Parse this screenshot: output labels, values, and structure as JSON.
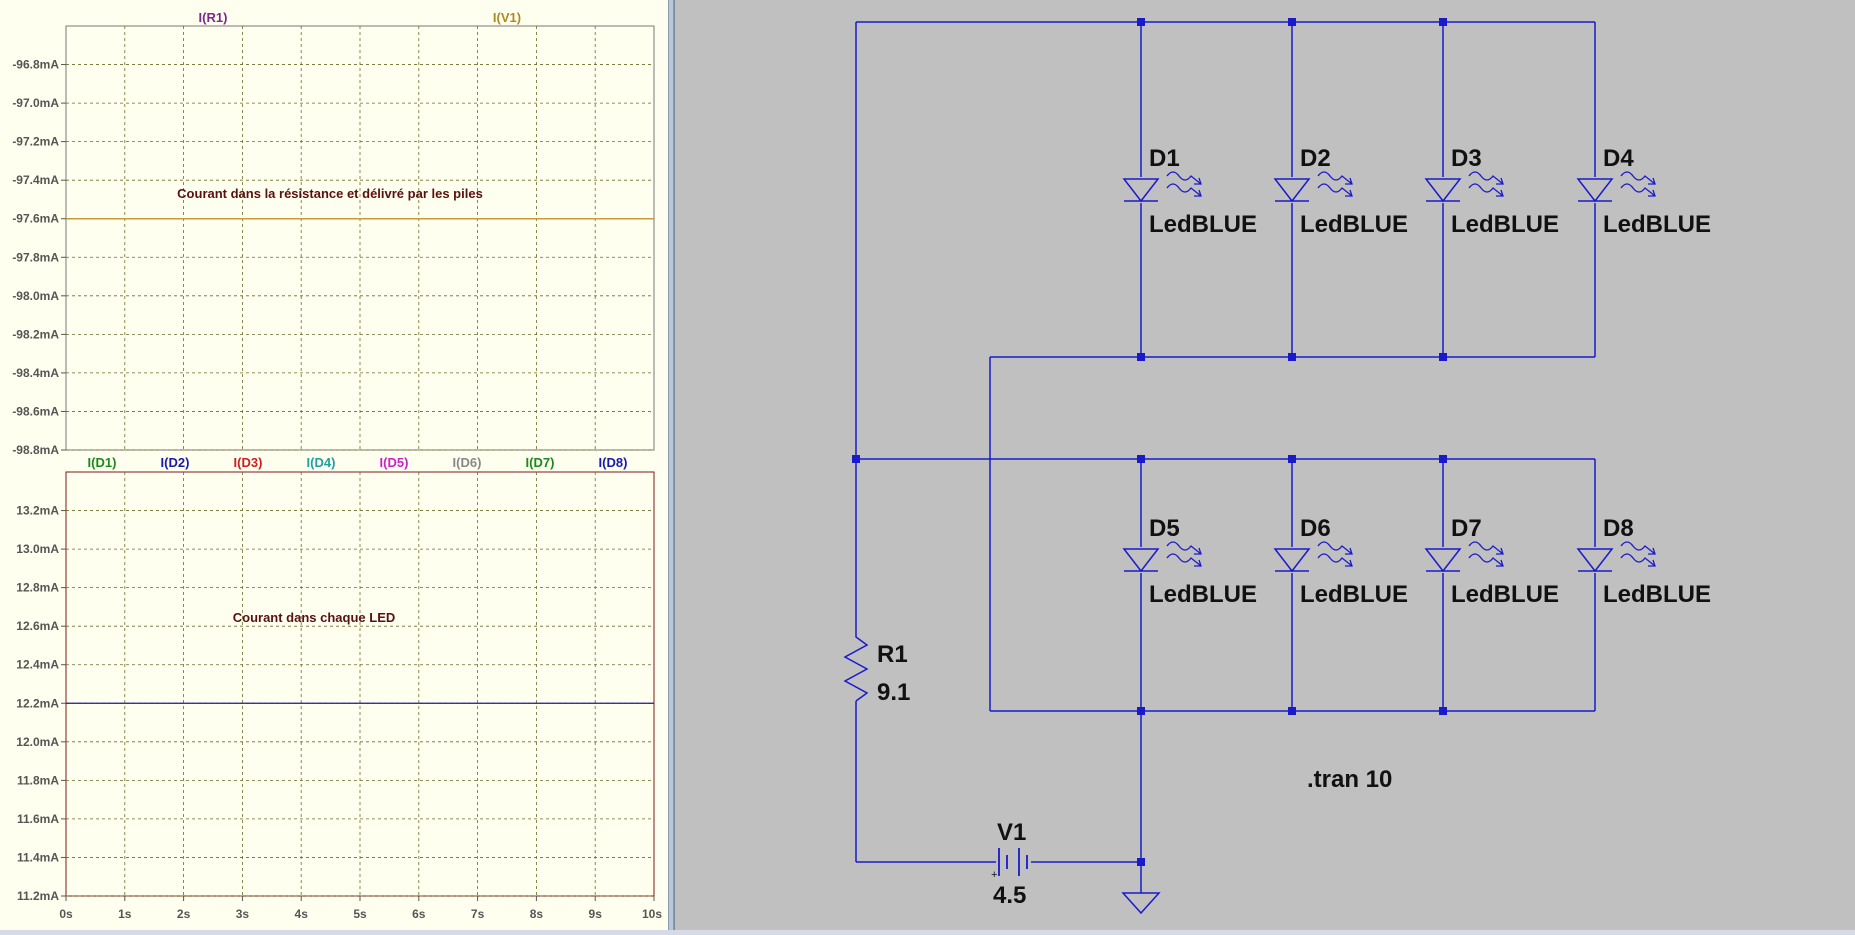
{
  "colors": {
    "plot_bg": "#fffff0",
    "grid": "#7a7a2a",
    "wire": "#1a1acc",
    "schematic_bg": "#c0c0c0",
    "trace_top": "#c89a3a",
    "trace_bottom": "#1a1a9a"
  },
  "plot_top": {
    "traces": [
      {
        "name": "I(R1)",
        "color": "#7a2a8a"
      },
      {
        "name": "I(V1)",
        "color": "#b08a20"
      }
    ],
    "y_ticks": [
      "-96.8mA",
      "-97.0mA",
      "-97.2mA",
      "-97.4mA",
      "-97.6mA",
      "-97.8mA",
      "-98.0mA",
      "-98.2mA",
      "-98.4mA",
      "-98.6mA",
      "-98.8mA"
    ],
    "y_range": [
      -98.8,
      -96.6
    ],
    "trace_value": -97.6,
    "annotation": "Courant dans la résistance et délivré par les piles"
  },
  "plot_bottom": {
    "traces": [
      {
        "name": "I(D1)",
        "color": "#1a8a1a"
      },
      {
        "name": "I(D2)",
        "color": "#1a1aaa"
      },
      {
        "name": "I(D3)",
        "color": "#cc2020"
      },
      {
        "name": "I(D4)",
        "color": "#20a0a0"
      },
      {
        "name": "I(D5)",
        "color": "#cc20cc"
      },
      {
        "name": "I(D6)",
        "color": "#888888"
      },
      {
        "name": "I(D7)",
        "color": "#1a8a1a"
      },
      {
        "name": "I(D8)",
        "color": "#1a1aaa"
      }
    ],
    "y_ticks": [
      "13.2mA",
      "13.0mA",
      "12.8mA",
      "12.6mA",
      "12.4mA",
      "12.2mA",
      "12.0mA",
      "11.8mA",
      "11.6mA",
      "11.4mA",
      "11.2mA"
    ],
    "y_range": [
      11.2,
      13.4
    ],
    "trace_value": 12.2,
    "annotation": "Courant dans chaque LED"
  },
  "x_ticks": [
    "0s",
    "1s",
    "2s",
    "3s",
    "4s",
    "5s",
    "6s",
    "7s",
    "8s",
    "9s",
    "10s"
  ],
  "schematic": {
    "diodes": [
      {
        "ref": "D1",
        "model": "LedBLUE"
      },
      {
        "ref": "D2",
        "model": "LedBLUE"
      },
      {
        "ref": "D3",
        "model": "LedBLUE"
      },
      {
        "ref": "D4",
        "model": "LedBLUE"
      },
      {
        "ref": "D5",
        "model": "LedBLUE"
      },
      {
        "ref": "D6",
        "model": "LedBLUE"
      },
      {
        "ref": "D7",
        "model": "LedBLUE"
      },
      {
        "ref": "D8",
        "model": "LedBLUE"
      }
    ],
    "resistor": {
      "ref": "R1",
      "value": "9.1"
    },
    "source": {
      "ref": "V1",
      "value": "4.5",
      "polarity": "+"
    },
    "directive": ".tran 10"
  }
}
